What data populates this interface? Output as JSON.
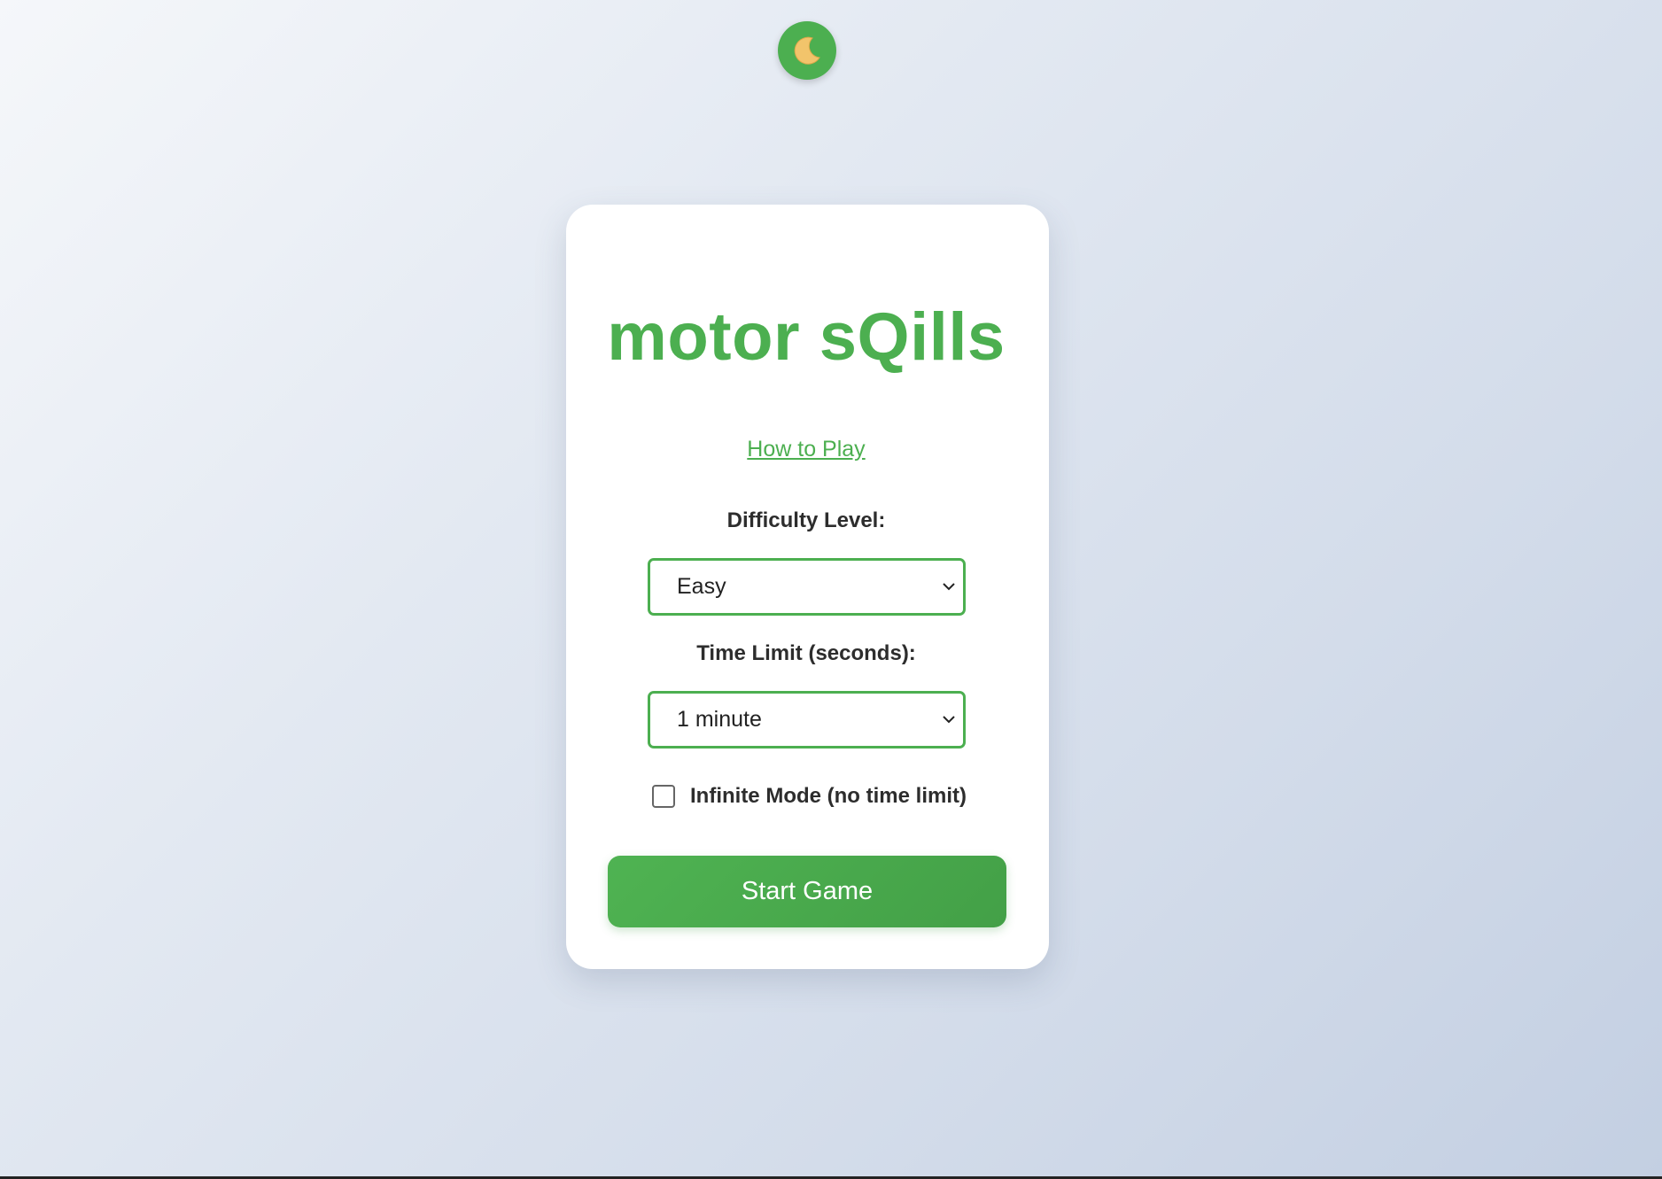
{
  "theme_toggle": {
    "icon": "crescent-moon-icon"
  },
  "title": "motor sQills",
  "how_to_play": "How to Play",
  "difficulty": {
    "label": "Difficulty Level:",
    "selected": "Easy"
  },
  "time_limit": {
    "label": "Time Limit (seconds):",
    "selected": "1 minute"
  },
  "infinite_mode": {
    "label": "Infinite Mode (no time limit)",
    "checked": false
  },
  "start_button": "Start Game",
  "colors": {
    "accent": "#4caf50",
    "card": "#ffffff",
    "text": "#2d2d2d"
  }
}
